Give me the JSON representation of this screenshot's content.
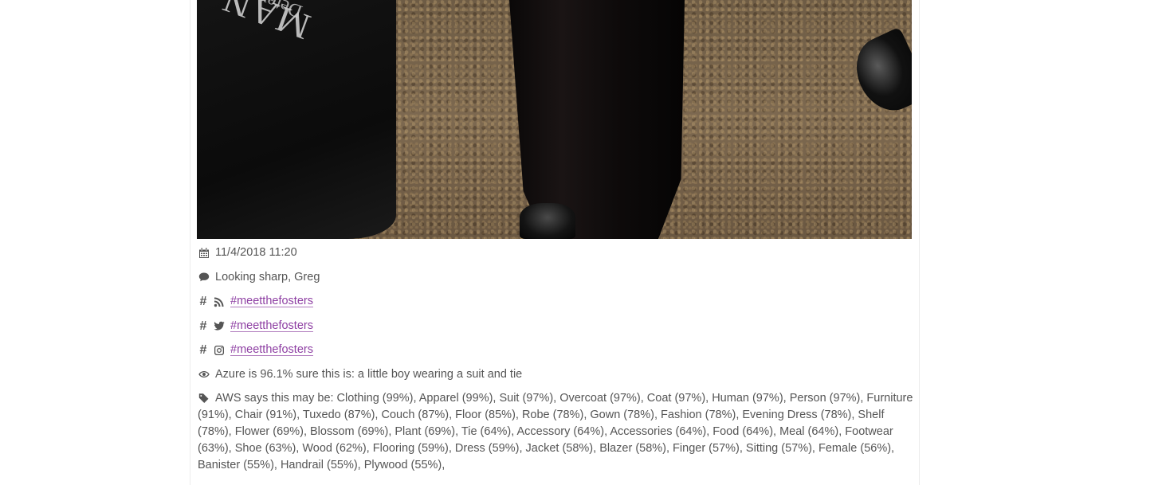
{
  "post": {
    "date": "11/4/2018 11:20",
    "caption": "Looking sharp, Greg",
    "hashtags": [
      {
        "network": "rss",
        "icon": "rss-icon",
        "text": "#meetthefosters"
      },
      {
        "network": "twitter",
        "icon": "twitter-icon",
        "text": "#meetthefosters"
      },
      {
        "network": "instagram",
        "icon": "instagram-icon",
        "text": "#meetthefosters"
      }
    ],
    "azure_caption": "Azure is 96.1% sure this is: a little boy wearing a suit and tie",
    "aws_labels": "AWS says this may be: Clothing (99%), Apparel (99%), Suit (97%), Overcoat (97%), Coat (97%), Human (97%), Person (97%), Furniture (91%), Chair (91%), Tuxedo (87%), Couch (87%), Floor (85%), Robe (78%), Gown (78%), Fashion (78%), Evening Dress (78%), Shelf (78%), Flower (69%), Blossom (69%), Plant (69%), Tie (64%), Accessory (64%), Accessories (64%), Food (64%), Meal (64%), Footwear (63%), Shoe (63%), Wood (62%), Flooring (59%), Dress (59%), Jacket (58%), Blazer (58%), Finger (57%), Sitting (57%), Female (56%), Banister (55%), Handrail (55%), Plywood (55%),"
  },
  "photo": {
    "bag_text": "MAN",
    "bag_text_small": "Deter"
  },
  "colors": {
    "text": "#555555",
    "link": "#8e3fa3"
  }
}
